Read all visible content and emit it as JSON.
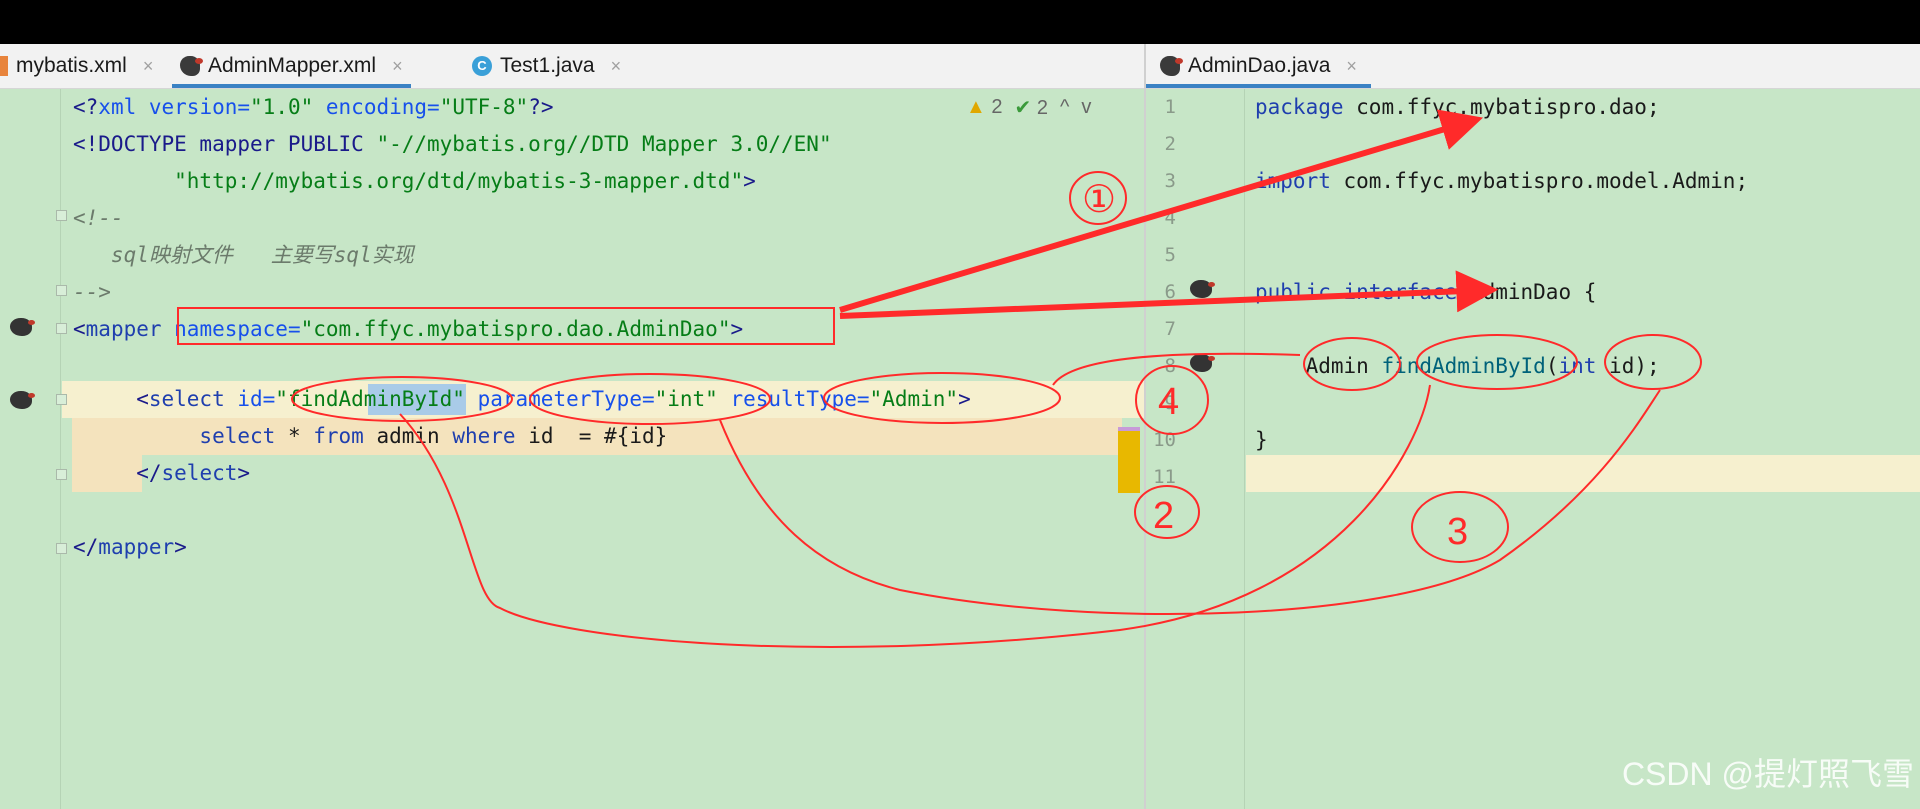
{
  "tabs_left": [
    {
      "label": "mybatis.xml",
      "close": "×",
      "icon": "xml-file-icon"
    },
    {
      "label": "AdminMapper.xml",
      "close": "×",
      "icon": "mybatis-bird-icon",
      "active": true
    },
    {
      "label": "Test1.java",
      "close": "×",
      "icon": "java-class-icon"
    }
  ],
  "tabs_right": [
    {
      "label": "AdminDao.java",
      "close": "×",
      "icon": "mybatis-bird-icon",
      "active": true
    }
  ],
  "inspection": {
    "warnings": "2",
    "checks": "2",
    "warn_icon": "▲",
    "check_icon": "✔",
    "up": "^",
    "down": "v"
  },
  "left_code": {
    "l1": {
      "a": "<?",
      "b": "xml",
      "c": " version=",
      "d": "\"1.0\"",
      "e": " encoding=",
      "f": "\"UTF-8\"",
      "g": "?>"
    },
    "l2": {
      "a": "<!DOCTYPE mapper PUBLIC ",
      "b": "\"-//mybatis.org//DTD Mapper 3.0//EN\""
    },
    "l3": {
      "a": "        \"http://mybatis.org/dtd/mybatis-3-mapper.dtd\"",
      "b": ">"
    },
    "l4": "<!--",
    "l5": "   sql映射文件   主要写sql实现",
    "l6": "-->",
    "l7": {
      "a": "<",
      "b": "mapper",
      "c": " namespace=",
      "d": "\"com.ffyc.mybatispro.dao.AdminDao\"",
      "e": ">"
    },
    "l9": {
      "a": "     <",
      "b": "select",
      "c": " id=",
      "d": "\"findAdminById\"",
      "e": " parameterType=",
      "f": "\"int\"",
      "g": " resultType=",
      "h": "\"Admin\"",
      "i": ">"
    },
    "l10": {
      "a": "          select",
      "b": " * ",
      "c": "from",
      "d": " admin ",
      "e": "where",
      "f": " id  = #{id}"
    },
    "l11": {
      "a": "     </",
      "b": "select",
      "c": ">"
    },
    "l13": {
      "a": "</",
      "b": "mapper",
      "c": ">"
    }
  },
  "right_code": {
    "line_numbers": [
      "1",
      "2",
      "3",
      "4",
      "5",
      "6",
      "7",
      "8",
      "9",
      "10",
      "11"
    ],
    "l1": {
      "a": "package",
      "b": " com.ffyc.mybatispro.dao;"
    },
    "l3": {
      "a": "import",
      "b": " com.ffyc.mybatispro.model.Admin;"
    },
    "l6": {
      "a": "public interface",
      "b": " AdminDao {"
    },
    "l8": {
      "a": "    Admin ",
      "b": "findAdminById",
      "c": "(",
      "d": "int",
      "e": " id);"
    },
    "l10": "}"
  },
  "annotations": {
    "n1": "①",
    "n2": "2",
    "n3": "3",
    "n4": "4"
  },
  "watermark": "CSDN @提灯照飞雪",
  "colors": {
    "editor_bg": "#c7e6c7",
    "annotation_red": "#ff2a2a",
    "tab_accent": "#3b82c4"
  }
}
